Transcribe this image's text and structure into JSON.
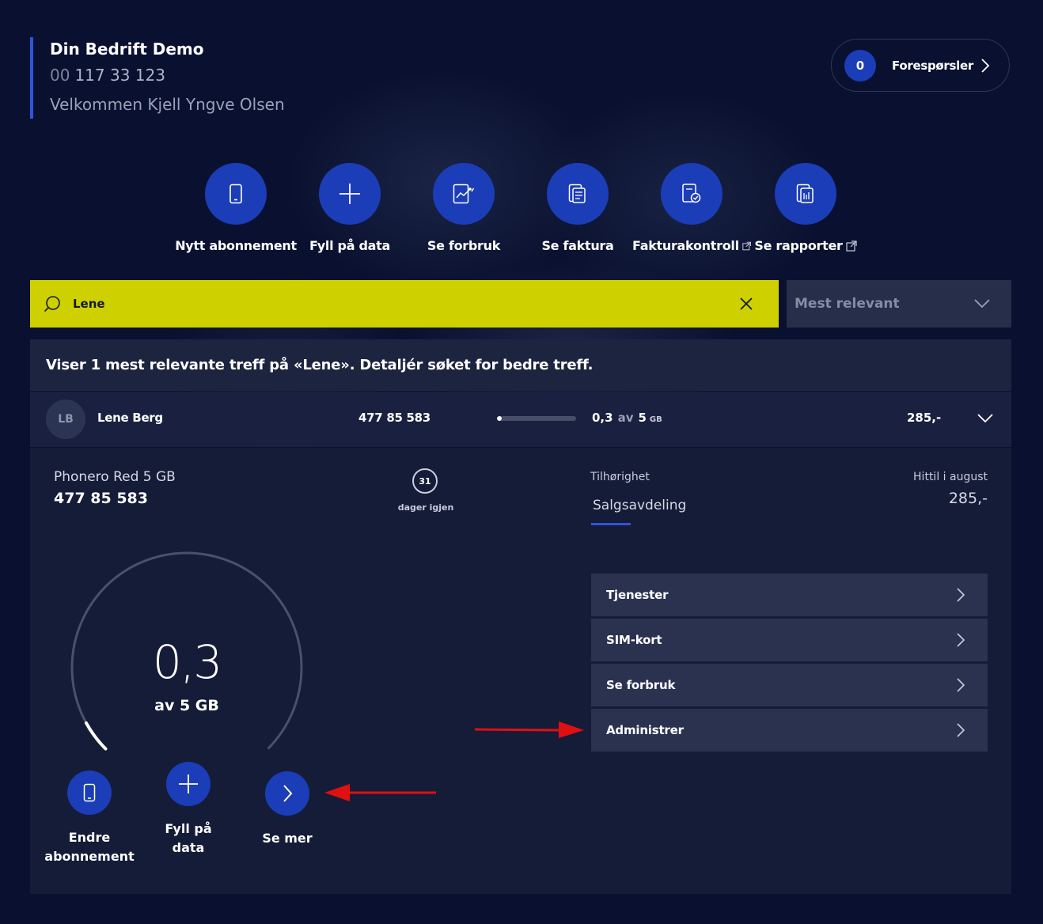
{
  "header": {
    "company_name": "Din Bedrift Demo",
    "phone_prefix": "00",
    "phone_number": "117 33 123",
    "welcome": "Velkommen Kjell Yngve Olsen"
  },
  "requests": {
    "count": "0",
    "label": "Forespørsler"
  },
  "quick_actions": [
    {
      "label": "Nytt abonnement",
      "icon": "phone-icon"
    },
    {
      "label": "Fyll på data",
      "icon": "plus-icon"
    },
    {
      "label": "Se forbruk",
      "icon": "chart-icon"
    },
    {
      "label": "Se faktura",
      "icon": "invoice-icon"
    },
    {
      "label": "Fakturakontroll",
      "icon": "invoice-check-icon",
      "external": true
    },
    {
      "label": "Se rapporter",
      "icon": "report-icon",
      "external": true
    }
  ],
  "search": {
    "value": "Lene",
    "sort_label": "Mest relevant"
  },
  "results": {
    "info": "Viser 1 mest relevante treff på «Lene». Detaljér søket for bedre treff."
  },
  "row": {
    "initials": "LB",
    "name": "Lene Berg",
    "number": "477 85 583",
    "used": "0,3",
    "of": "av",
    "total": "5",
    "unit": "GB",
    "usage_fraction": 0.06,
    "price": "285,-"
  },
  "detail": {
    "plan_name": "Phonero Red 5 GB",
    "plan_number": "477 85 583",
    "days_left": "31",
    "days_label": "dager igjen",
    "affiliation_label": "Tilhørighet",
    "affiliation_value": "Salgsavdeling",
    "hittil_label": "Hittil i august",
    "hittil_value": "285,-",
    "gauge_value": "0,3",
    "gauge_sub": "av 5 GB",
    "gauge_fraction": 0.06
  },
  "bottom_actions": [
    {
      "label": "Endre abonnement",
      "icon": "phone-icon"
    },
    {
      "label": "Fyll på data",
      "icon": "plus-icon"
    },
    {
      "label": "Se mer",
      "icon": "chevron-right-icon"
    }
  ],
  "menu": [
    {
      "label": "Tjenester"
    },
    {
      "label": "SIM-kort"
    },
    {
      "label": "Se forbruk"
    },
    {
      "label": "Administrer"
    }
  ],
  "colors": {
    "background": "#0a1130",
    "accent_blue": "#1b3db8",
    "search_yellow": "#cfd000",
    "annotation_red": "#e01010"
  }
}
